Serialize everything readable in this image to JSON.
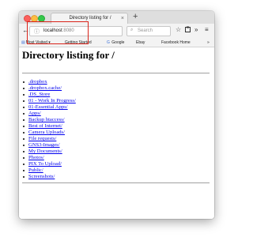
{
  "tab": {
    "title": "Directory listing for /",
    "close": "×",
    "new": "+"
  },
  "toolbar": {
    "back": "←",
    "url_host": "localhost",
    "url_port": ":8080",
    "reload": "C",
    "search_placeholder": "Search",
    "search_icon": "⌕",
    "star": "☆",
    "more": "»",
    "menu": "≡"
  },
  "bookmarks": [
    {
      "label": "Most Visited",
      "suffix": "▾"
    },
    {
      "label": "Getting Started"
    },
    {
      "label": "Google",
      "icon": "G"
    },
    {
      "label": "Ebay"
    },
    {
      "label": "Facebook Home"
    }
  ],
  "bookmarks_overflow": "»",
  "page": {
    "heading": "Directory listing for /",
    "entries": [
      ".dropbox",
      ".dropbox.cache/",
      ".DS_Store",
      "01 - Work In Progress/",
      "01-Essential Apps/",
      "Apps/",
      "Backup htaccess/",
      "Best of Internet/",
      "Camera Uploads/",
      "File requests/",
      "GNS3-Images/",
      "My Documents/",
      "Photos/",
      "PIX To Upload/",
      "Public/",
      "Screenshots/"
    ]
  },
  "colors": {
    "annotation": "#d9231a",
    "link": "#0000ee"
  }
}
